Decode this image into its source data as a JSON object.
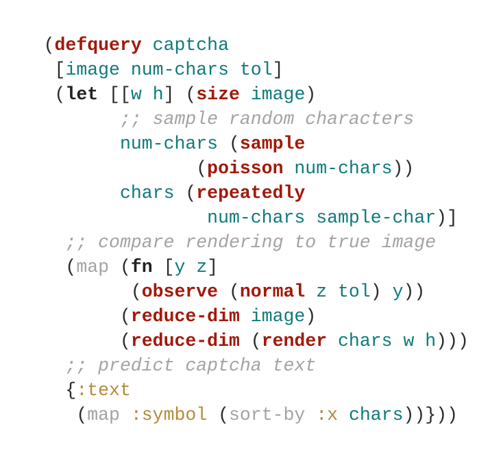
{
  "tokens": [
    [
      "(",
      "defquery",
      " ",
      "captcha"
    ],
    [
      " [",
      "image",
      " ",
      "num-chars",
      " ",
      "tol",
      "]"
    ],
    [
      " (",
      "let",
      " [[",
      "w",
      " ",
      "h",
      "] (",
      "size",
      " ",
      "image",
      ")"
    ],
    [
      "       ",
      ";; sample random characters"
    ],
    [
      "       ",
      "num-chars",
      " (",
      "sample"
    ],
    [
      "              (",
      "poisson",
      " ",
      "num-chars",
      "))"
    ],
    [
      "       ",
      "chars",
      " (",
      "repeatedly"
    ],
    [
      "               ",
      "num-chars",
      " ",
      "sample-char",
      ")]"
    ],
    [
      "  ",
      ";; compare rendering to true image"
    ],
    [
      "  (",
      "map",
      " (",
      "fn",
      " [",
      "y",
      " ",
      "z",
      "]"
    ],
    [
      "        (",
      "observe",
      " (",
      "normal",
      " ",
      "z",
      " ",
      "tol",
      ") ",
      "y",
      "))"
    ],
    [
      "       (",
      "reduce-dim",
      " ",
      "image",
      ")"
    ],
    [
      "       (",
      "reduce-dim",
      " (",
      "render",
      " ",
      "chars",
      " ",
      "w",
      " ",
      "h",
      ")))"
    ],
    [
      "  ",
      ";; predict captcha text"
    ],
    [
      "  {",
      ":text"
    ],
    [
      "   (",
      "map",
      " ",
      ":symbol",
      " (",
      "sort-by",
      " ",
      ":x",
      " ",
      "chars",
      "))}))"
    ]
  ]
}
